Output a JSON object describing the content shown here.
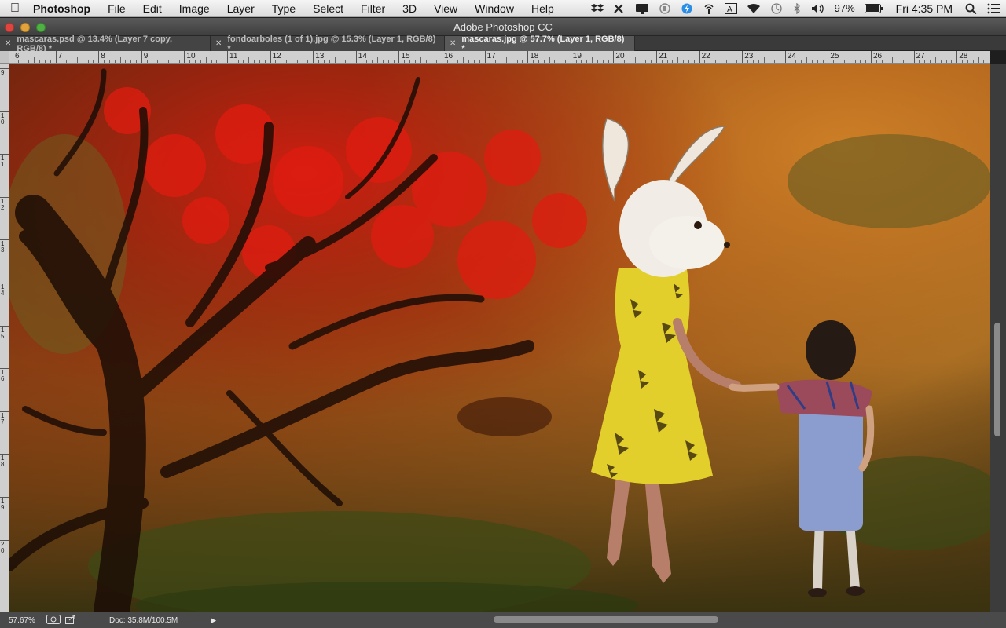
{
  "menubar": {
    "app_name": "Photoshop",
    "items": [
      "File",
      "Edit",
      "Image",
      "Layer",
      "Type",
      "Select",
      "Filter",
      "3D",
      "View",
      "Window",
      "Help"
    ],
    "battery": "97%",
    "clock": "Fri 4:35 PM"
  },
  "window": {
    "title": "Adobe Photoshop CC"
  },
  "tabs": [
    {
      "label": "mascaras.psd @ 13.4% (Layer 7 copy, RGB/8) *",
      "active": false
    },
    {
      "label": "fondoarboles (1 of 1).jpg @ 15.3% (Layer 1, RGB/8) *",
      "active": false
    },
    {
      "label": "mascaras.jpg @ 57.7% (Layer 1, RGB/8) *",
      "active": true
    }
  ],
  "ruler": {
    "labels": [
      "6",
      "7",
      "8",
      "9",
      "10",
      "11",
      "12",
      "13",
      "14",
      "15",
      "16",
      "17",
      "18",
      "19",
      "20",
      "21",
      "22",
      "23",
      "24",
      "25",
      "26",
      "27",
      "28"
    ],
    "vertical_labels": [
      "9",
      "1 0",
      "1 1",
      "1 2",
      "1 3",
      "1 4",
      "1 5",
      "1 6",
      "1 7",
      "1 8",
      "1 9",
      "2 0"
    ]
  },
  "status": {
    "zoom": "57.67%",
    "doc": "Doc: 35.8M/100.5M"
  },
  "colors": {
    "menubar": "#e8e8e8",
    "titlebar": "#4a4a4a",
    "close_light": "#e0443e",
    "minimize_light": "#e1a43a",
    "zoom_light": "#4fb043"
  }
}
